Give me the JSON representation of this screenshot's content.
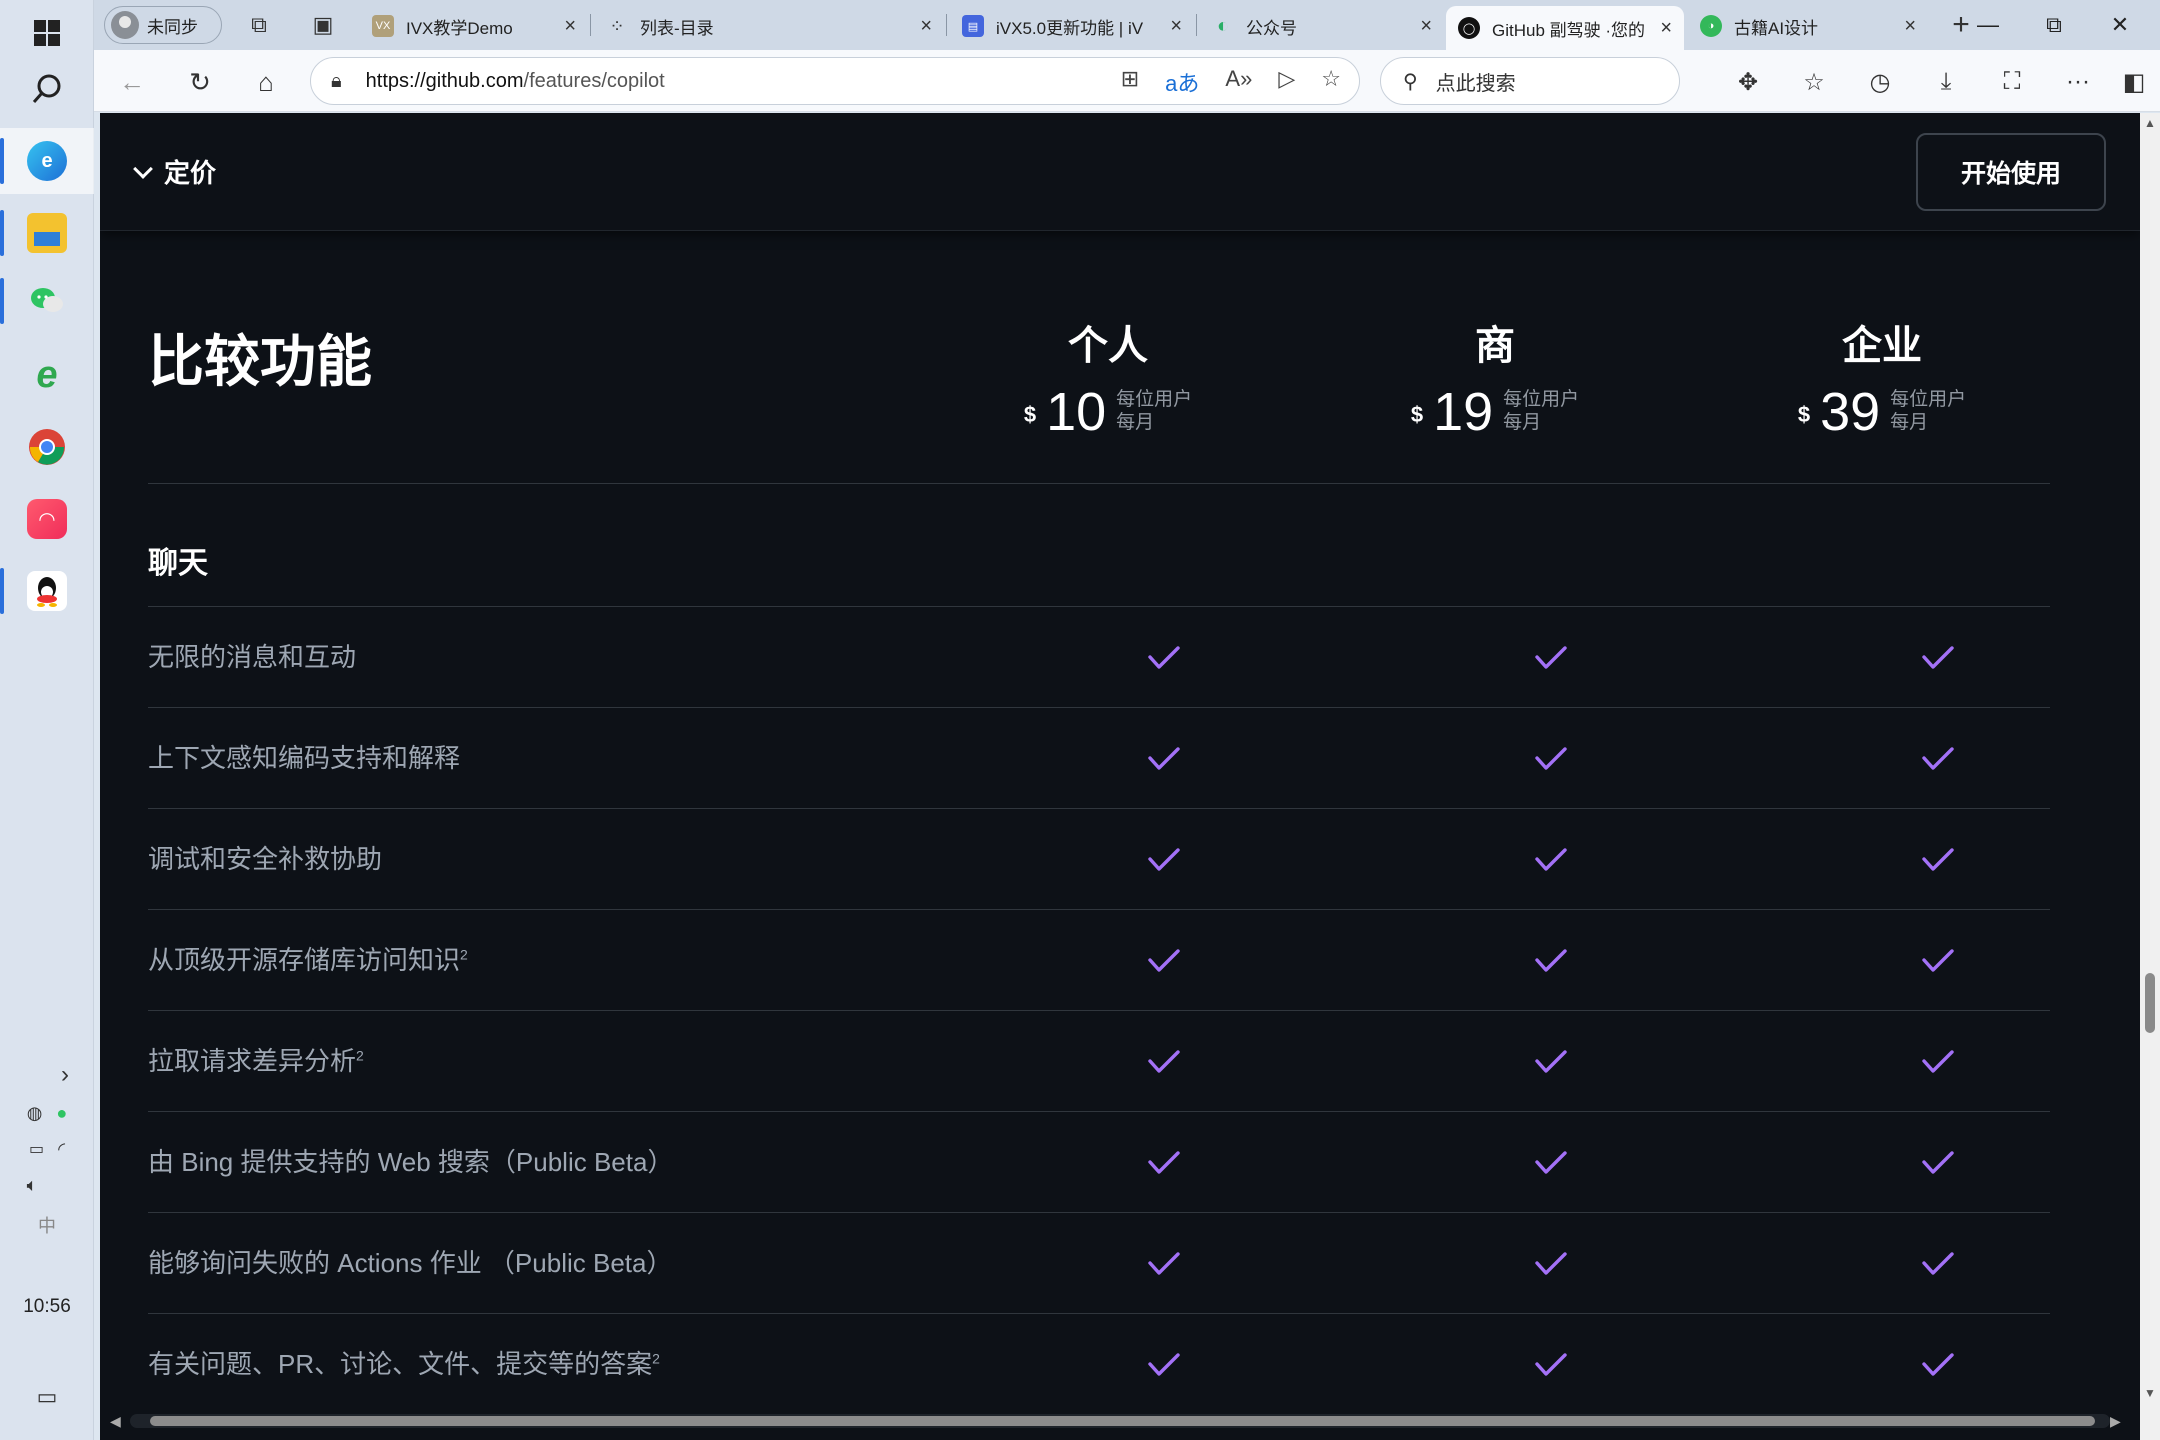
{
  "taskbar": {
    "clock": "10:56",
    "apps": [
      {
        "name": "windows-start",
        "icon": "⊞"
      },
      {
        "name": "search",
        "icon": "⚲"
      },
      {
        "name": "edge",
        "icon": "e"
      },
      {
        "name": "file-explorer",
        "icon": "▭"
      },
      {
        "name": "wechat",
        "icon": "✉"
      },
      {
        "name": "internet-explorer",
        "icon": "e"
      },
      {
        "name": "chrome",
        "icon": "◉"
      },
      {
        "name": "music-app",
        "icon": "♪"
      },
      {
        "name": "qq",
        "icon": "◍"
      }
    ],
    "ime": "中"
  },
  "browser": {
    "profile_label": "未同步",
    "tabs": [
      {
        "title": "IVX教学Demo",
        "fav_color": "#b0a07a",
        "fav_text": "VX"
      },
      {
        "title": "列表-目录",
        "fav_color": "#555555",
        "fav_text": "⁘"
      },
      {
        "title": "iVX5.0更新功能 | iV",
        "fav_color": "#4466dd",
        "fav_text": "▤"
      },
      {
        "title": "公众号",
        "fav_color": "#2aae67",
        "fav_text": "◐"
      },
      {
        "title": "GitHub 副驾驶 ·您的",
        "fav_color": "#111111",
        "fav_text": "◯"
      },
      {
        "title": "古籍AI设计",
        "fav_color": "#33b85a",
        "fav_text": "◑"
      }
    ],
    "new_tab": "+",
    "url_host": "https://github.com",
    "url_path": "/features/copilot",
    "search_placeholder": "点此搜索"
  },
  "page": {
    "pricing_label": "定价",
    "cta_label": "开始使用",
    "compare_title": "比较功能",
    "plans": [
      {
        "name": "个人",
        "currency": "$",
        "price": "10",
        "unit1": "每位用户",
        "unit2": "每月"
      },
      {
        "name": "商",
        "currency": "$",
        "price": "19",
        "unit1": "每位用户",
        "unit2": "每月"
      },
      {
        "name": "企业",
        "currency": "$",
        "price": "39",
        "unit1": "每位用户",
        "unit2": "每月"
      }
    ],
    "section_title": "聊天",
    "features": [
      {
        "label": "无限的消息和互动",
        "sup": ""
      },
      {
        "label": "上下文感知编码支持和解释",
        "sup": ""
      },
      {
        "label": "调试和安全补救协助",
        "sup": ""
      },
      {
        "label": "从顶级开源存储库访问知识",
        "sup": "2"
      },
      {
        "label": "拉取请求差异分析",
        "sup": "2"
      },
      {
        "label": "由 Bing 提供支持的 Web 搜索（Public Beta）",
        "sup": ""
      },
      {
        "label": "能够询问失败的 Actions 作业 （Public Beta）",
        "sup": ""
      },
      {
        "label": "有关问题、PR、讨论、文件、提交等的答案",
        "sup": "2"
      }
    ],
    "check_color": "#a371f7"
  }
}
